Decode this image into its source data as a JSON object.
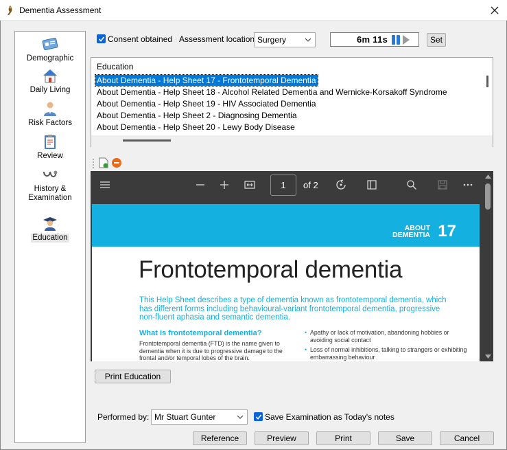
{
  "window": {
    "title": "Dementia Assessment"
  },
  "nav": {
    "items": [
      {
        "label": "Demographic",
        "icon": "id-card-icon"
      },
      {
        "label": "Daily Living",
        "icon": "house-icon"
      },
      {
        "label": "Risk Factors",
        "icon": "doctor-icon"
      },
      {
        "label": "Review",
        "icon": "clipboard-icon"
      },
      {
        "label_1": "History &",
        "label_2": "Examination",
        "icon": "stethoscope-icon"
      },
      {
        "label": "Education",
        "icon": "graduate-icon"
      }
    ]
  },
  "consent": {
    "label": "Consent obtained",
    "checked": true
  },
  "location": {
    "label": "Assessment location:",
    "value": "Surgery"
  },
  "timer": {
    "value": "6m 11s"
  },
  "set_button": "Set",
  "education": {
    "header": "Education",
    "items": [
      "About Dementia - Help Sheet 17 - Frontotemporal Dementia",
      "About Dementia - Help Sheet 18 - Alcohol Related Dementia and Wernicke-Korsakoff Syndrome",
      "About Dementia - Help Sheet 19 - HIV Associated Dementia",
      "About Dementia - Help Sheet 2 - Diagnosing Dementia",
      "About Dementia - Help Sheet 20 - Lewy Body Disease"
    ],
    "selected_index": 0
  },
  "pdf": {
    "page": "1",
    "of_total": "of 2",
    "band_about": "ABOUT",
    "band_dementia": "DEMENTIA",
    "band_number": "17",
    "title": "Frontotemporal dementia",
    "intro": "This Help Sheet describes a type of dementia known as frontotemporal dementia, which has different forms including behavioural-variant frontotemporal dementia, progressive non-fluent aphasia and semantic dementia.",
    "heading": "What is frontotemporal dementia?",
    "paragraph": "Frontotemporal dementia (FTD) is the name given to dementia when it is due to progressive damage to the frontal and/or temporal lobes of the brain.",
    "bullets": [
      "Apathy or lack of motivation, abandoning hobbies or avoiding social contact",
      "Loss of normal inhibitions, talking to strangers or exhibiting embarrassing behaviour"
    ]
  },
  "print_education": "Print Education",
  "performed_by": {
    "label": "Performed by:",
    "value": "Mr Stuart Gunter"
  },
  "save_exam": {
    "label": "Save Examination as Today's notes",
    "checked": true
  },
  "buttons": {
    "reference": "Reference",
    "preview": "Preview",
    "print": "Print",
    "save": "Save",
    "cancel": "Cancel"
  },
  "colors": {
    "accent": "#0078d7",
    "pdf_band": "#14b1e0",
    "pdf_toolbar": "#3b3b3b"
  }
}
